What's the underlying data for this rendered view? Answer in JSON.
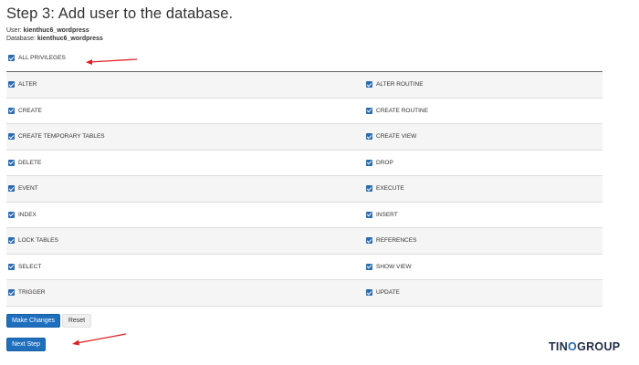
{
  "page": {
    "title": "Step 3: Add user to the database.",
    "user_label": "User: ",
    "user_value": "kienthuc6_wordpress",
    "db_label": "Database: ",
    "db_value": "kienthuc6_wordpress"
  },
  "all_privileges": {
    "label": "ALL PRIVILEGES",
    "checked": true
  },
  "privileges": [
    {
      "left": "ALTER",
      "right": "ALTER ROUTINE"
    },
    {
      "left": "CREATE",
      "right": "CREATE ROUTINE"
    },
    {
      "left": "CREATE TEMPORARY TABLES",
      "right": "CREATE VIEW"
    },
    {
      "left": "DELETE",
      "right": "DROP"
    },
    {
      "left": "EVENT",
      "right": "EXECUTE"
    },
    {
      "left": "INDEX",
      "right": "INSERT"
    },
    {
      "left": "LOCK TABLES",
      "right": "REFERENCES"
    },
    {
      "left": "SELECT",
      "right": "SHOW VIEW"
    },
    {
      "left": "TRIGGER",
      "right": "UPDATE"
    }
  ],
  "buttons": {
    "make_changes": "Make Changes",
    "reset": "Reset",
    "next_step": "Next Step"
  },
  "logo": {
    "part1": "TIN",
    "part2": "O",
    "part3": "GROUP"
  },
  "colors": {
    "primary": "#1f6fbf",
    "checkbox": "#2b6cb0",
    "annotation_arrow": "#e02020"
  }
}
